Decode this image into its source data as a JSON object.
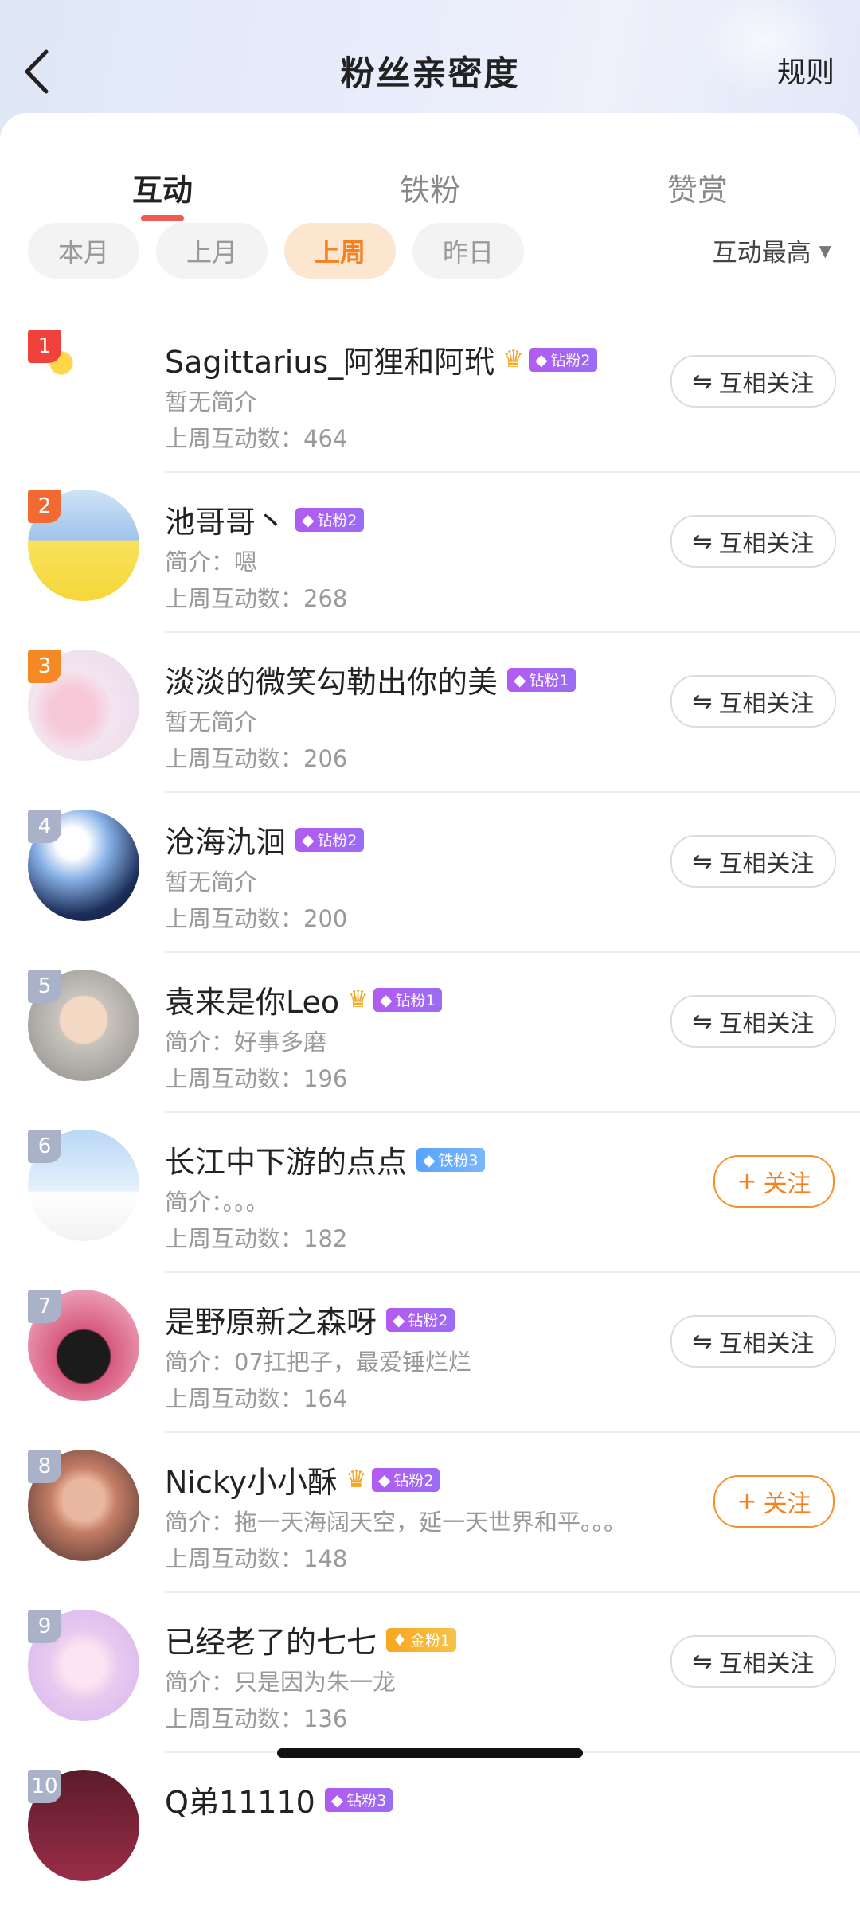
{
  "header": {
    "title": "粉丝亲密度",
    "rules_label": "规则"
  },
  "tabs": [
    {
      "label": "互动"
    },
    {
      "label": "铁粉"
    },
    {
      "label": "赞赏"
    }
  ],
  "filters": {
    "chips": [
      {
        "label": "本月"
      },
      {
        "label": "上月"
      },
      {
        "label": "上周"
      },
      {
        "label": "昨日"
      }
    ],
    "selected": "上周",
    "sort_label": "互动最高"
  },
  "buttons": {
    "mutual_label": "互相关注",
    "follow_label": "关注"
  },
  "fans": [
    {
      "rank": "1",
      "name": "Sagittarius_阿狸和阿玳",
      "badge": "钻粉2",
      "intro": "暂无简介",
      "count": "上周互动数：464",
      "status": "mutual"
    },
    {
      "rank": "2",
      "name": "池哥哥丶",
      "badge": "钻粉2",
      "intro": "简介：嗯",
      "count": "上周互动数：268",
      "status": "mutual"
    },
    {
      "rank": "3",
      "name": "淡淡的微笑勾勒出你的美",
      "badge": "钻粉1",
      "intro": "暂无简介",
      "count": "上周互动数：206",
      "status": "mutual"
    },
    {
      "rank": "4",
      "name": "沧海氿洄",
      "badge": "钻粉2",
      "intro": "暂无简介",
      "count": "上周互动数：200",
      "status": "mutual"
    },
    {
      "rank": "5",
      "name": "袁来是你Leo",
      "badge": "钻粉1",
      "intro": "简介：好事多磨",
      "count": "上周互动数：196",
      "status": "mutual"
    },
    {
      "rank": "6",
      "name": "长江中下游的点点",
      "badge": "铁粉3",
      "intro": "简介：。。。",
      "count": "上周互动数：182",
      "status": "follow"
    },
    {
      "rank": "7",
      "name": "是野原新之森呀",
      "badge": "钻粉2",
      "intro": "简介：07扛把子，最爱锤烂烂",
      "count": "上周互动数：164",
      "status": "mutual"
    },
    {
      "rank": "8",
      "name": "Nicky小小酥",
      "badge": "钻粉2",
      "intro": "简介：拖一天海阔天空，延一天世界和平。。。",
      "count": "上周互动数：148",
      "status": "follow"
    },
    {
      "rank": "9",
      "name": "已经老了的七七",
      "badge": "金粉1",
      "intro": "简介：只是因为朱一龙",
      "count": "上周互动数：136",
      "status": "mutual"
    },
    {
      "rank": "10",
      "name": "Q弟11110",
      "badge": "钻粉3",
      "intro": "",
      "count": "",
      "status": ""
    }
  ]
}
